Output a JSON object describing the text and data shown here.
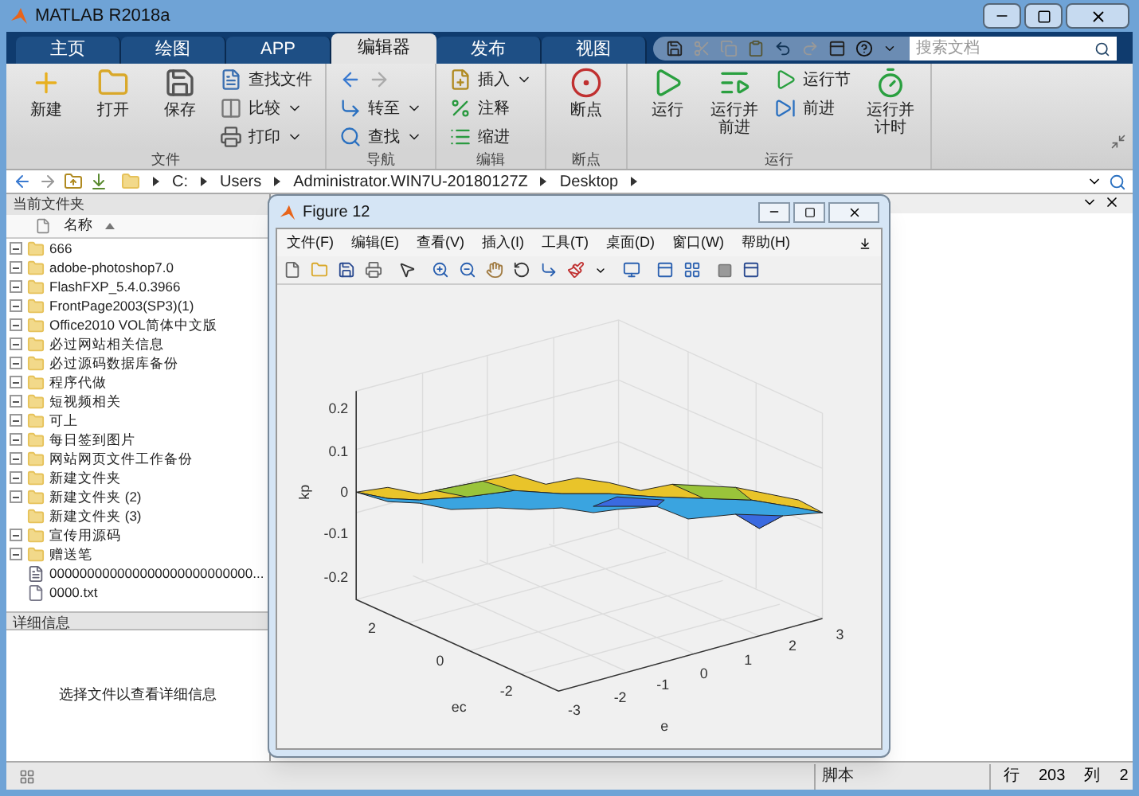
{
  "window": {
    "title": "MATLAB R2018a"
  },
  "tabs": [
    {
      "label": "主页",
      "selected": false
    },
    {
      "label": "绘图",
      "selected": false
    },
    {
      "label": "APP",
      "selected": false
    },
    {
      "label": "编辑器",
      "selected": true
    },
    {
      "label": "发布",
      "selected": false
    },
    {
      "label": "视图",
      "selected": false
    }
  ],
  "search": {
    "placeholder": "搜索文档"
  },
  "ribbon": [
    {
      "label": "文件",
      "buttons": [
        {
          "kind": "large",
          "label": "新建"
        },
        {
          "kind": "large",
          "label": "打开"
        },
        {
          "kind": "large",
          "label": "保存"
        },
        {
          "kind": "stack",
          "items": [
            {
              "label": "查找文件",
              "dropdown": false
            },
            {
              "label": "比较",
              "dropdown": true
            },
            {
              "label": "打印",
              "dropdown": true
            }
          ]
        }
      ]
    },
    {
      "label": "导航",
      "buttons": [
        {
          "kind": "stack",
          "items": [
            {
              "label": "转至",
              "dropdown": true
            },
            {
              "label": "查找",
              "dropdown": true
            }
          ]
        }
      ]
    },
    {
      "label": "编辑",
      "buttons": [
        {
          "kind": "stack",
          "items": [
            {
              "label": "插入",
              "dropdown": true
            },
            {
              "label": "注释",
              "dropdown": false
            },
            {
              "label": "缩进",
              "dropdown": false
            }
          ]
        }
      ]
    },
    {
      "label": "断点",
      "buttons": [
        {
          "kind": "large",
          "label": "断点"
        }
      ]
    },
    {
      "label": "运行",
      "buttons": [
        {
          "kind": "large",
          "label": "运行"
        },
        {
          "kind": "large",
          "label": "运行并前进"
        },
        {
          "kind": "stack",
          "items": [
            {
              "label": "运行节",
              "dropdown": false
            },
            {
              "label": "前进",
              "dropdown": false
            }
          ]
        },
        {
          "kind": "large",
          "label": "运行并计时"
        }
      ]
    }
  ],
  "address": [
    "C:",
    "Users",
    "Administrator.WIN7U-20180127Z",
    "Desktop"
  ],
  "folder_panel": {
    "title": "当前文件夹",
    "column": "名称",
    "files": [
      {
        "name": "666",
        "kind": "folder",
        "expandable": true
      },
      {
        "name": "adobe-photoshop7.0",
        "kind": "folder",
        "expandable": true
      },
      {
        "name": "FlashFXP_5.4.0.3966",
        "kind": "folder",
        "expandable": true
      },
      {
        "name": "FrontPage2003(SP3)(1)",
        "kind": "folder",
        "expandable": true
      },
      {
        "name": "Office2010 VOL简体中文版",
        "kind": "folder",
        "expandable": true
      },
      {
        "name": "必过网站相关信息",
        "kind": "folder",
        "expandable": true
      },
      {
        "name": "必过源码数据库备份",
        "kind": "folder",
        "expandable": true
      },
      {
        "name": "程序代做",
        "kind": "folder",
        "expandable": true
      },
      {
        "name": "短视频相关",
        "kind": "folder",
        "expandable": true
      },
      {
        "name": "可上",
        "kind": "folder",
        "expandable": true
      },
      {
        "name": "每日签到图片",
        "kind": "folder",
        "expandable": true
      },
      {
        "name": "网站网页文件工作备份",
        "kind": "folder",
        "expandable": true
      },
      {
        "name": "新建文件夹",
        "kind": "folder",
        "expandable": true
      },
      {
        "name": "新建文件夹 (2)",
        "kind": "folder",
        "expandable": true
      },
      {
        "name": "新建文件夹 (3)",
        "kind": "folder",
        "expandable": false
      },
      {
        "name": "宣传用源码",
        "kind": "folder",
        "expandable": true
      },
      {
        "name": "赠送笔",
        "kind": "folder",
        "expandable": true
      },
      {
        "name": "000000000000000000000000000...",
        "kind": "script",
        "expandable": false
      },
      {
        "name": "0000.txt",
        "kind": "text",
        "expandable": false
      }
    ]
  },
  "details": {
    "title": "详细信息",
    "message": "选择文件以查看详细信息"
  },
  "figure": {
    "title": "Figure 12",
    "menu": [
      "文件(F)",
      "编辑(E)",
      "查看(V)",
      "插入(I)",
      "工具(T)",
      "桌面(D)",
      "窗口(W)",
      "帮助(H)"
    ],
    "zlabel": "kp",
    "zticks": [
      "0.2",
      "0.1",
      "0",
      "-0.1",
      "-0.2"
    ],
    "ylabel": "ec",
    "yticks": [
      "2",
      "0",
      "-2"
    ],
    "xlabel": "e",
    "xticks": [
      "-3",
      "-2",
      "-1",
      "0",
      "1",
      "2",
      "3"
    ]
  },
  "status_bar": {
    "file_type": "脚本",
    "line_label": "行",
    "line": "203",
    "col_label": "列",
    "col": "2"
  }
}
